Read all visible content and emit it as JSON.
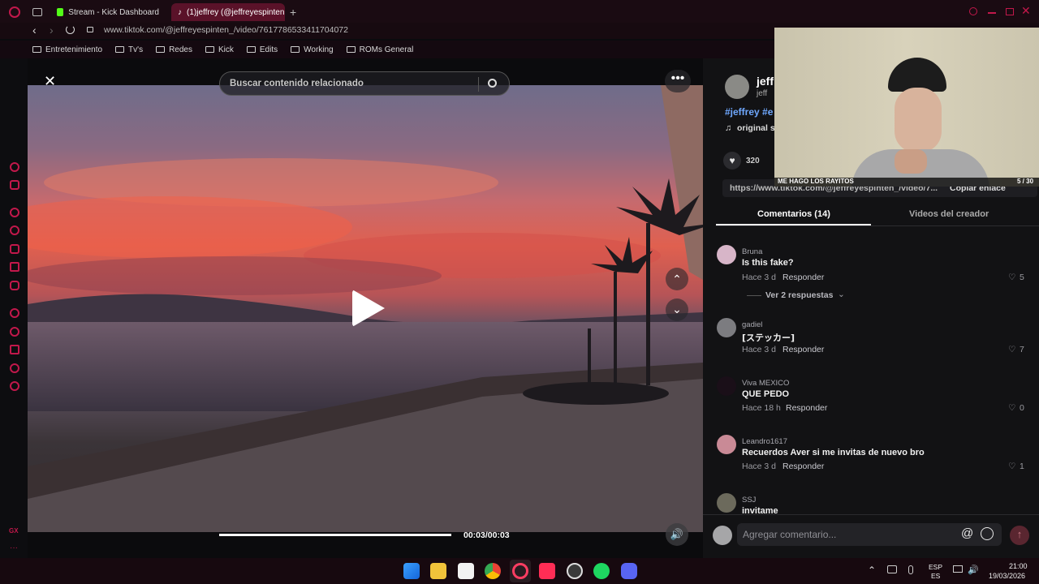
{
  "browser": {
    "tabs": [
      {
        "label": "Stream - Kick Dashboard",
        "active": false
      },
      {
        "label": "(1)jeffrey (@jeffreyespinten",
        "active": true
      }
    ],
    "url": "www.tiktok.com/@jeffreyespinten_/video/7617786533411704072"
  },
  "bookmarks": [
    "Entretenimiento",
    "Tv's",
    "Redes",
    "Kick",
    "Edits",
    "Working",
    "ROMs General"
  ],
  "video": {
    "search_placeholder": "Buscar contenido relacionado",
    "time": "00:03/00:03",
    "progress": 1.0
  },
  "creator": {
    "name_short": "jeff",
    "handle_short": "jeff",
    "hashtags": "#jeffrey #e",
    "sound": "original s",
    "likes": "320",
    "link": "https://www.tiktok.com/@jeffreyespinten_/video/7...",
    "copy_link": "Copiar enlace"
  },
  "tabs": {
    "comments": "Comentarios (14)",
    "creator_videos": "Videos del creador"
  },
  "comments": [
    {
      "user": "Bruna",
      "text": "Is this fake?",
      "time": "Hace 3 d",
      "reply": "Responder",
      "likes": "5",
      "replies": "Ver 2 respuestas"
    },
    {
      "user": "gadiel",
      "text": "[ステッカー]",
      "time": "Hace 3 d",
      "reply": "Responder",
      "likes": "7"
    },
    {
      "user": "Viva MEXICO",
      "text": "QUE PEDO",
      "time": "Hace 18 h",
      "reply": "Responder",
      "likes": "0"
    },
    {
      "user": "Leandro1617",
      "text": "Recuerdos Aver si me invitas de nuevo bro",
      "time": "Hace 3 d",
      "reply": "Responder",
      "likes": "1"
    },
    {
      "user": "SSJ",
      "text": "invitame",
      "time": "",
      "reply": "",
      "likes": ""
    }
  ],
  "comment_input": {
    "placeholder": "Agregar comentario..."
  },
  "webcam": {
    "caption": "ME HAGO LOS RAYITOS",
    "counter": "5 / 30"
  },
  "system": {
    "lang1": "ESP",
    "lang2": "ES",
    "time": "21:00",
    "date": "19/03/2026"
  },
  "colors": {
    "accent": "#c2184b",
    "tab_active": "#5a1229",
    "link": "#6fa8ff"
  }
}
